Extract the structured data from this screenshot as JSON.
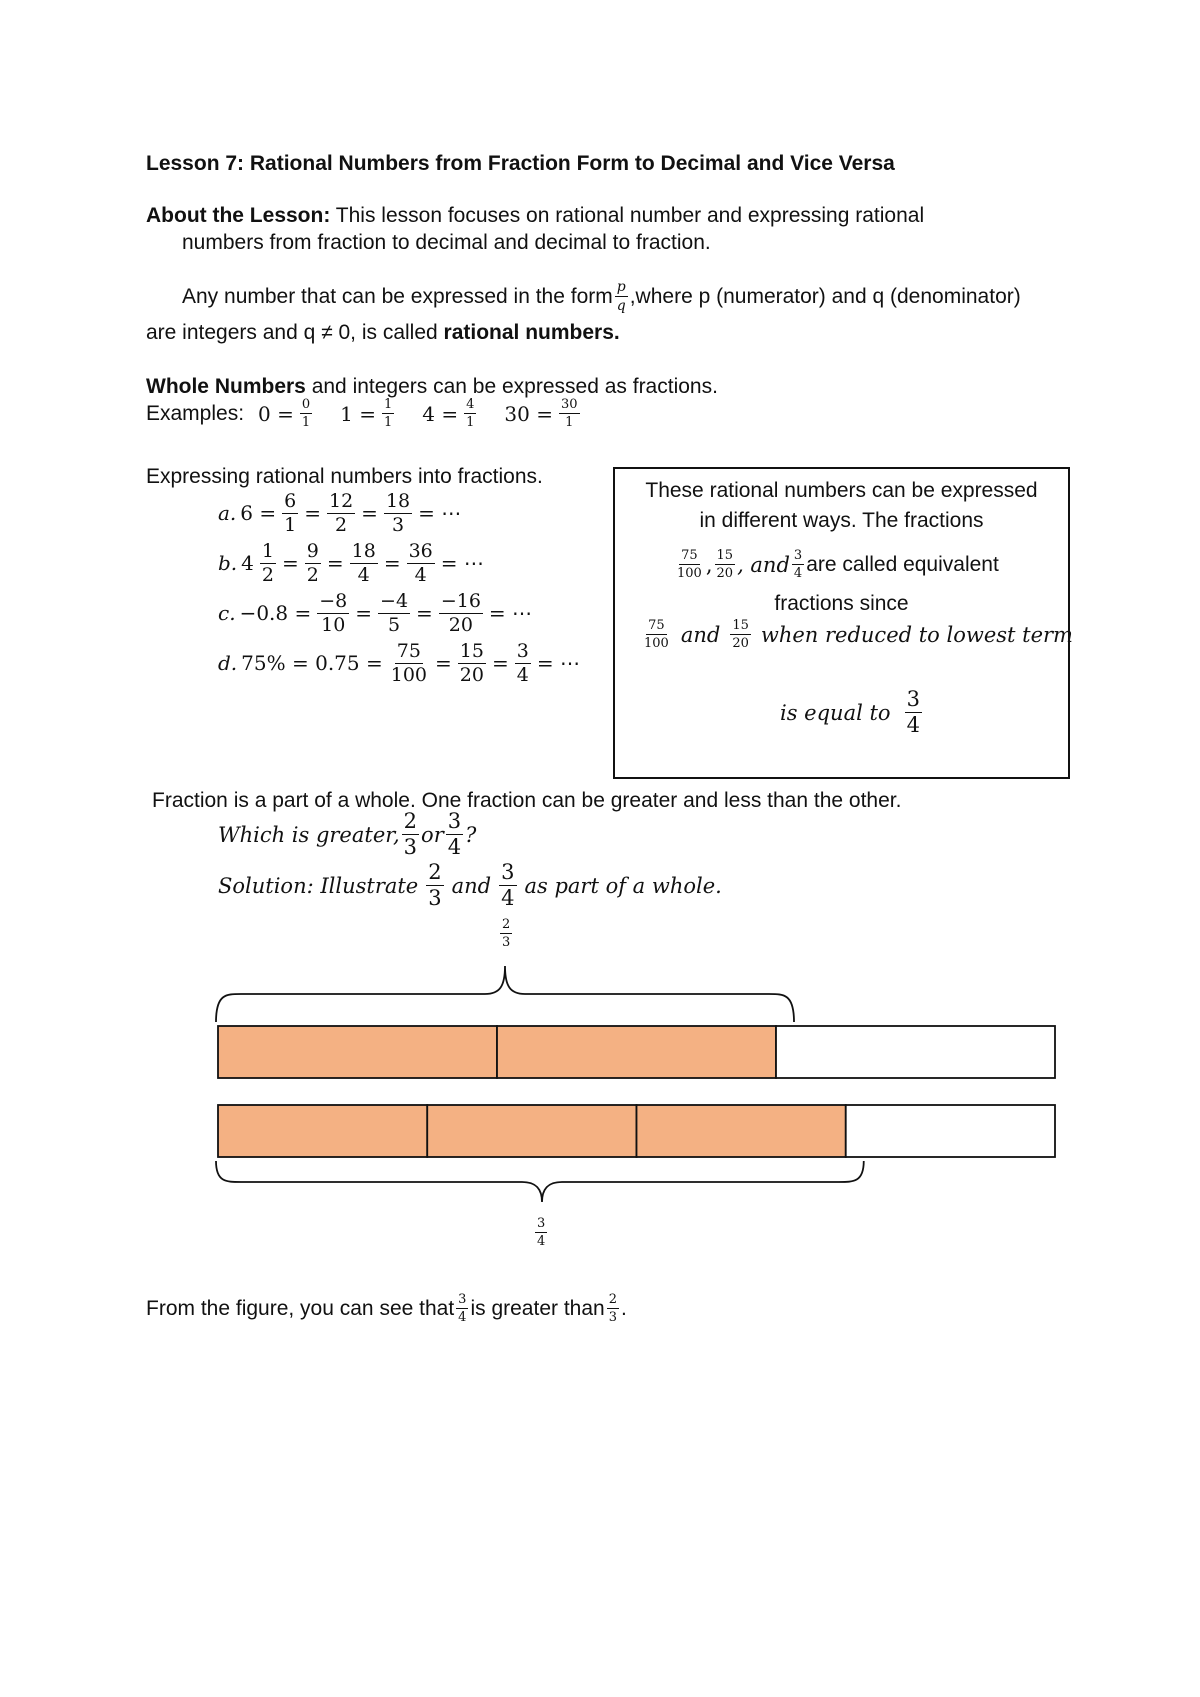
{
  "title": "Lesson 7: Rational Numbers from Fraction Form to Decimal and Vice Versa",
  "about": {
    "label": "About the Lesson:",
    "line1": " This lesson focuses on rational number and expressing rational",
    "line2": "numbers from fraction to decimal and decimal to fraction."
  },
  "definition": {
    "prefix": "Any number that can be expressed in the form ",
    "frac": {
      "n": "p",
      "d": "q"
    },
    "suffix": ",where p (numerator) and q (denominator)",
    "line2_prefix": "are integers and q ≠ 0, is called ",
    "line2_bold": "rational numbers."
  },
  "whole": {
    "bold": "Whole Numbers",
    "rest": " and integers can be expressed as fractions.",
    "examples_label": "Examples:",
    "examples": [
      {
        "lhs": "0 =",
        "n": "0",
        "d": "1"
      },
      {
        "lhs": "1 =",
        "n": "1",
        "d": "1"
      },
      {
        "lhs": "4 =",
        "n": "4",
        "d": "1"
      },
      {
        "lhs": "30 =",
        "n": "30",
        "d": "1"
      }
    ]
  },
  "expressing": {
    "heading": "Expressing rational numbers into fractions.",
    "items": [
      {
        "label": "a.",
        "lhs": "6 =",
        "fracs": [
          [
            "6",
            "1"
          ],
          [
            "12",
            "2"
          ],
          [
            "18",
            "3"
          ]
        ],
        "tail": "= ⋯"
      },
      {
        "label": "b.",
        "lhs": "4",
        "mixed": [
          "1",
          "2"
        ],
        "fracs": [
          [
            "9",
            "2"
          ],
          [
            "18",
            "4"
          ],
          [
            "36",
            "4"
          ]
        ],
        "tail": "= ⋯"
      },
      {
        "label": "c.",
        "lhs": "−0.8 =",
        "fracs": [
          [
            "−8",
            "10"
          ],
          [
            "−4",
            "5"
          ],
          [
            "−16",
            "20"
          ]
        ],
        "tail": "= ⋯"
      },
      {
        "label": "d.",
        "lhs": "75% = 0.75 =",
        "fracs": [
          [
            "75",
            "100"
          ],
          [
            "15",
            "20"
          ],
          [
            "3",
            "4"
          ]
        ],
        "tail": "= ⋯"
      }
    ]
  },
  "box": {
    "line1": "These rational numbers can be expressed",
    "line2": "in different ways. The fractions",
    "line3_fracs": [
      [
        "75",
        "100"
      ],
      [
        "15",
        "20"
      ]
    ],
    "line3_and": ", and ",
    "line3_frac_last": [
      "3",
      "4"
    ],
    "line3_text": " are called equivalent",
    "line4": "fractions since",
    "line5_and": "and",
    "line5_text": "when reduced to lowest term",
    "line6_text": "is equal to",
    "line6_frac": [
      "3",
      "4"
    ]
  },
  "comparison": {
    "intro": "Fraction is a part of a whole. One fraction can be greater and less than the other.",
    "question_prefix": "Which is greater,",
    "question_or": "or",
    "question_end": "?",
    "fracA": [
      "2",
      "3"
    ],
    "fracB": [
      "3",
      "4"
    ],
    "solution_prefix": "Solution: Illustrate",
    "solution_and": "and",
    "solution_suffix": "as part of a whole."
  },
  "figure": {
    "fill_color": "#f4b183",
    "bars": [
      {
        "name": "two-thirds",
        "parts": 3,
        "shaded": 2,
        "label": [
          "2",
          "3"
        ]
      },
      {
        "name": "three-fourths",
        "parts": 4,
        "shaded": 3,
        "label": [
          "3",
          "4"
        ]
      }
    ]
  },
  "conclusion": {
    "prefix": "From the figure, you can see that ",
    "fracA": [
      "3",
      "4"
    ],
    "middle": " is greater than ",
    "fracB": [
      "2",
      "3"
    ],
    "end": "."
  }
}
